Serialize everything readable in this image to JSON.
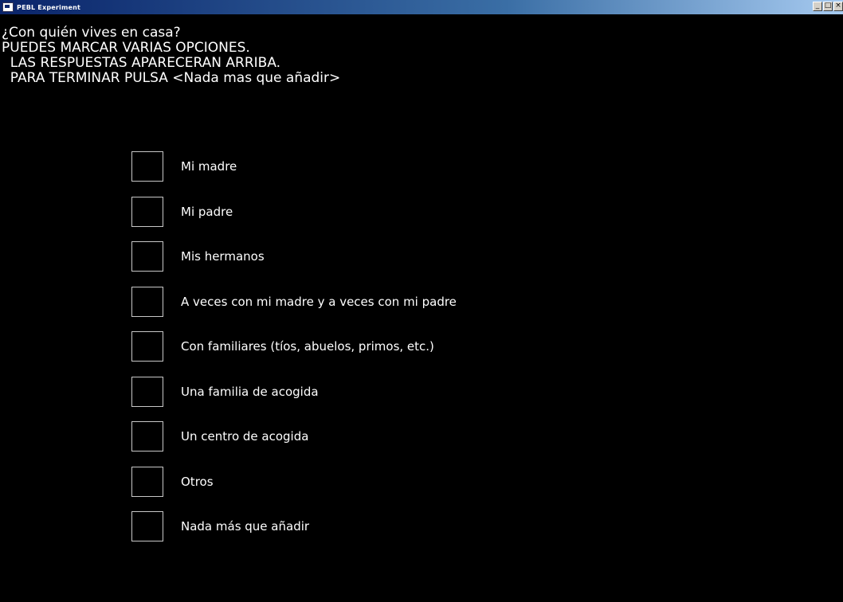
{
  "window": {
    "title": "PEBL Experiment",
    "controls": [
      "_",
      "□",
      "×"
    ]
  },
  "question": {
    "lines": [
      "¿Con quién vives en casa?",
      "PUEDES MARCAR VARIAS OPCIONES.",
      "  LAS RESPUESTAS APARECERAN ARRIBA.",
      "  PARA TERMINAR PULSA <Nada mas que añadir>"
    ]
  },
  "options": [
    {
      "label": "Mi madre",
      "checked": false
    },
    {
      "label": "Mi padre",
      "checked": false
    },
    {
      "label": "Mis hermanos",
      "checked": false
    },
    {
      "label": "A veces con mi madre y a veces con mi padre",
      "checked": false
    },
    {
      "label": "Con familiares (tíos, abuelos, primos, etc.)",
      "checked": false
    },
    {
      "label": "Una familia de acogida",
      "checked": false
    },
    {
      "label": "Un centro de acogida",
      "checked": false
    },
    {
      "label": "Otros",
      "checked": false
    },
    {
      "label": "Nada más que añadir",
      "checked": false
    }
  ],
  "colors": {
    "background": "#000000",
    "text": "#ffffff",
    "checkbox_border": "#c8c8c8",
    "titlebar": "#0a246a"
  }
}
